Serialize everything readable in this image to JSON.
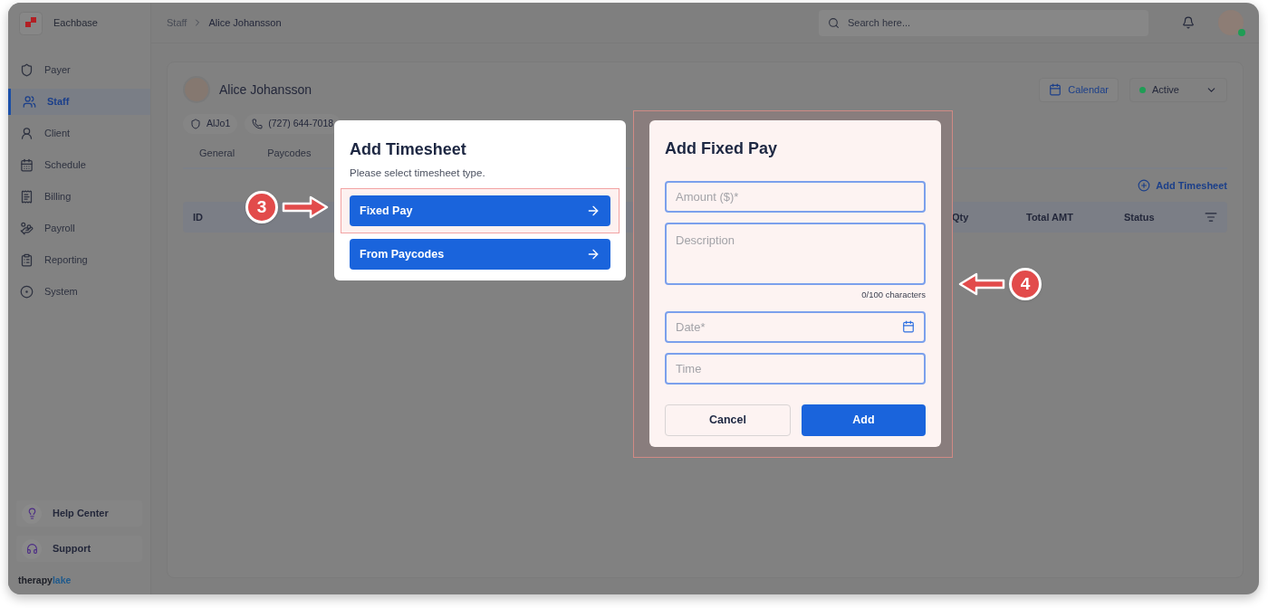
{
  "app": {
    "name": "Eachbase"
  },
  "sidebar": {
    "items": [
      {
        "label": "Payer",
        "selected": false
      },
      {
        "label": "Staff",
        "selected": true
      },
      {
        "label": "Client",
        "selected": false
      },
      {
        "label": "Schedule",
        "selected": false
      },
      {
        "label": "Billing",
        "selected": false
      },
      {
        "label": "Payroll",
        "selected": false
      },
      {
        "label": "Reporting",
        "selected": false
      },
      {
        "label": "System",
        "selected": false
      }
    ],
    "footer_items": [
      {
        "label": "Help Center"
      },
      {
        "label": "Support"
      }
    ],
    "brand": {
      "first": "therapy",
      "second": "lake"
    }
  },
  "breadcrumb": [
    "Staff",
    "Alice Johansson"
  ],
  "search": {
    "placeholder": "Search here..."
  },
  "profile": {
    "name": "Alice Johansson",
    "chips": [
      {
        "kind": "id",
        "text": "AlJo1"
      },
      {
        "kind": "phone",
        "text": "(727) 644-7018"
      }
    ]
  },
  "actions": {
    "calendar": "Calendar",
    "status": {
      "label": "Active",
      "color": "#1f9d55"
    }
  },
  "tabs": [
    {
      "label": "General",
      "selected": false
    },
    {
      "label": "Paycodes",
      "selected": false
    }
  ],
  "add_timesheet": "Add Timesheet",
  "table": {
    "columns": [
      "ID",
      "Qty",
      "Total AMT",
      "Status"
    ]
  },
  "timesheet_dialog": {
    "title": "Add Timesheet",
    "subtitle": "Please select timesheet type.",
    "options": [
      {
        "label": "Fixed Pay",
        "highlighted": true
      },
      {
        "label": "From Paycodes",
        "highlighted": false
      }
    ]
  },
  "fixed_pay_dialog": {
    "title": "Add Fixed Pay",
    "highlighted": true,
    "fields": [
      {
        "kind": "text",
        "placeholder": "Amount ($)*"
      },
      {
        "kind": "textarea",
        "placeholder": "Description",
        "counter": "0/100 characters"
      },
      {
        "kind": "date",
        "placeholder": "Date*"
      },
      {
        "kind": "text",
        "placeholder": "Time"
      }
    ],
    "buttons": [
      {
        "kind": "secondary",
        "label": "Cancel"
      },
      {
        "kind": "primary",
        "label": "Add"
      }
    ]
  },
  "annotations": [
    {
      "number": "3",
      "kind": "right"
    },
    {
      "number": "4",
      "kind": "left"
    }
  ]
}
